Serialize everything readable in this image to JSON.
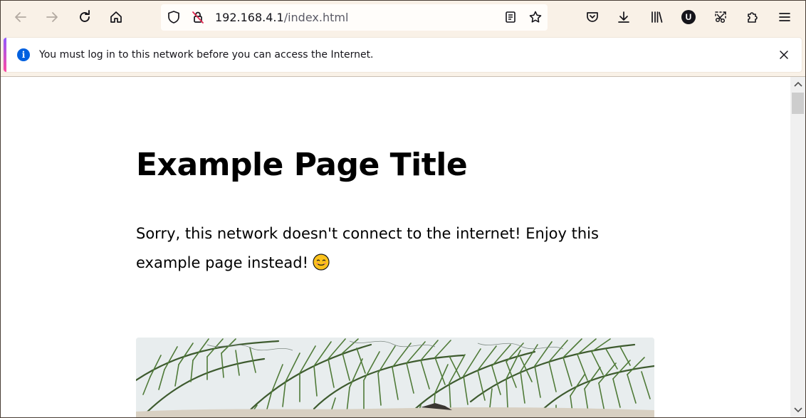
{
  "browser": {
    "url_host": "192.168.4.1",
    "url_path": "/index.html",
    "account_badge": "U"
  },
  "notification": {
    "message": "You must log in to this network before you can access the Internet.",
    "info_glyph": "i"
  },
  "page": {
    "title": "Example Page Title",
    "text": "Sorry, this network doesn't connect to the internet! Enjoy this example page instead!"
  },
  "icons": [
    "back-icon",
    "forward-icon",
    "reload-icon",
    "home-icon",
    "shield-icon",
    "insecure-lock-icon",
    "reader-view-icon",
    "bookmark-star-icon",
    "pocket-icon",
    "downloads-icon",
    "library-icon",
    "account-icon",
    "screenshot-icon",
    "extensions-icon",
    "menu-icon",
    "close-icon",
    "smiley-emoji-icon"
  ],
  "colors": {
    "toolbar": "#f9f1e7",
    "info_blue": "#0060df",
    "accent_gradient_start": "#9059ff",
    "accent_gradient_end": "#ff4aa2",
    "disabled_nav": "#b3aaa2"
  }
}
